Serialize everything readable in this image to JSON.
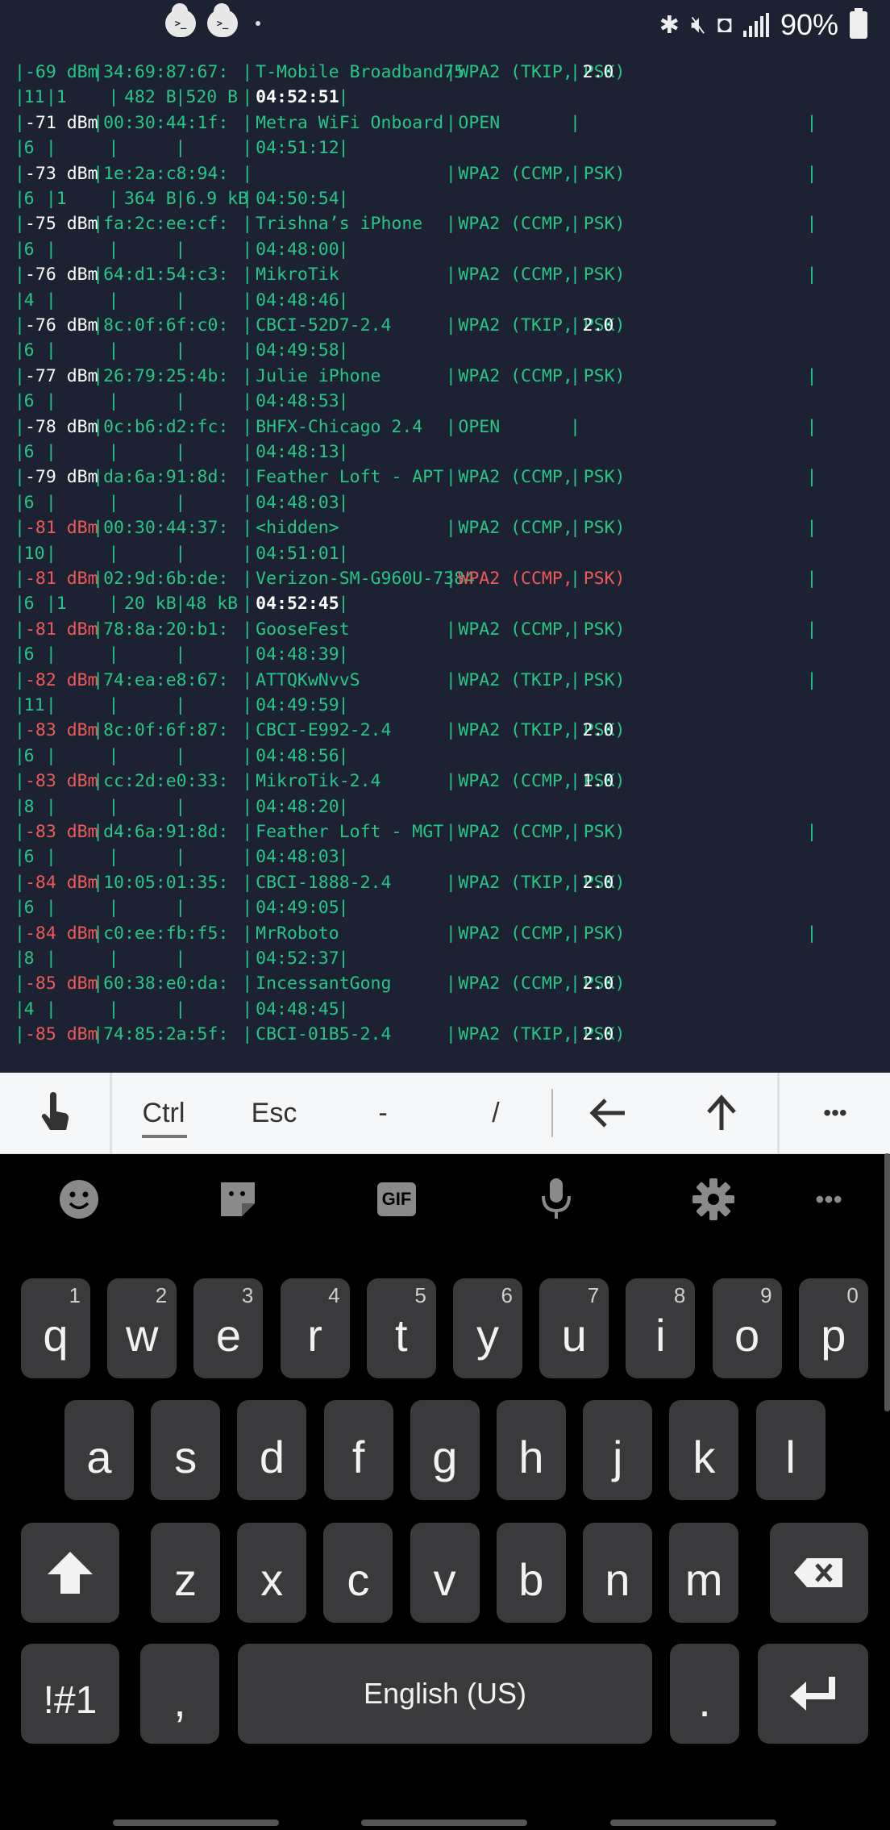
{
  "status_bar": {
    "left_icons": [
      "terminal-cloud-icon",
      "terminal-cloud-icon"
    ],
    "cloud_glyph": ">_",
    "right_icons": [
      "bluetooth-icon",
      "mute-icon",
      "nfc-icon",
      "signal-icon"
    ],
    "battery": "90%"
  },
  "terminal": {
    "rows": [
      [
        {
          "t": "-69 dBm",
          "c": "green"
        },
        {
          "t": "34:69:87:67:",
          "c": "green"
        },
        {
          "t": "T-Mobile Broadband75",
          "c": "green"
        },
        {
          "t": "WPA2 (TKIP, PSK)",
          "c": "green"
        },
        {
          "t": "2.0",
          "c": "white"
        }
      ],
      [
        {
          "t": "11",
          "c": "green"
        },
        {
          "t": "1",
          "c": "green"
        },
        {
          "t": "482 B",
          "c": "green"
        },
        {
          "t": "520 B",
          "c": "green"
        },
        {
          "t": "04:52:51",
          "c": "white bold"
        }
      ],
      [
        {
          "t": "-71 dBm",
          "c": "white"
        },
        {
          "t": "00:30:44:1f:",
          "c": "green"
        },
        {
          "t": "Metra WiFi Onboard",
          "c": "green"
        },
        {
          "t": "OPEN",
          "c": "green"
        }
      ],
      [
        {
          "t": "6",
          "c": "green"
        },
        {
          "t": "",
          "c": "green"
        },
        {
          "t": "",
          "c": "green"
        },
        {
          "t": "",
          "c": "green"
        },
        {
          "t": "04:51:12",
          "c": "green"
        }
      ],
      [
        {
          "t": "-73 dBm",
          "c": "white"
        },
        {
          "t": "1e:2a:c8:94:",
          "c": "green"
        },
        {
          "t": "",
          "c": "green"
        },
        {
          "t": "WPA2 (CCMP, PSK)",
          "c": "green"
        }
      ],
      [
        {
          "t": "6",
          "c": "green"
        },
        {
          "t": "1",
          "c": "green"
        },
        {
          "t": "364 B",
          "c": "green"
        },
        {
          "t": "6.9 kB",
          "c": "green"
        },
        {
          "t": "04:50:54",
          "c": "green"
        }
      ],
      [
        {
          "t": "-75 dBm",
          "c": "white"
        },
        {
          "t": "fa:2c:ee:cf:",
          "c": "green"
        },
        {
          "t": "Trishna’s iPhone",
          "c": "green"
        },
        {
          "t": "WPA2 (CCMP, PSK)",
          "c": "green"
        }
      ],
      [
        {
          "t": "6",
          "c": "green"
        },
        {
          "t": "",
          "c": "green"
        },
        {
          "t": "",
          "c": "green"
        },
        {
          "t": "",
          "c": "green"
        },
        {
          "t": "04:48:00",
          "c": "green"
        }
      ],
      [
        {
          "t": "-76 dBm",
          "c": "white"
        },
        {
          "t": "64:d1:54:c3:",
          "c": "green"
        },
        {
          "t": "MikroTik",
          "c": "green"
        },
        {
          "t": "WPA2 (CCMP, PSK)",
          "c": "green"
        }
      ],
      [
        {
          "t": "4",
          "c": "green"
        },
        {
          "t": "",
          "c": "green"
        },
        {
          "t": "",
          "c": "green"
        },
        {
          "t": "",
          "c": "green"
        },
        {
          "t": "04:48:46",
          "c": "green"
        }
      ],
      [
        {
          "t": "-76 dBm",
          "c": "white"
        },
        {
          "t": "8c:0f:6f:c0:",
          "c": "green"
        },
        {
          "t": "CBCI-52D7-2.4",
          "c": "green"
        },
        {
          "t": "WPA2 (TKIP, PSK)",
          "c": "green"
        },
        {
          "t": "2.0",
          "c": "white"
        }
      ],
      [
        {
          "t": "6",
          "c": "green"
        },
        {
          "t": "",
          "c": "green"
        },
        {
          "t": "",
          "c": "green"
        },
        {
          "t": "",
          "c": "green"
        },
        {
          "t": "04:49:58",
          "c": "green"
        }
      ],
      [
        {
          "t": "-77 dBm",
          "c": "white"
        },
        {
          "t": "26:79:25:4b:",
          "c": "green"
        },
        {
          "t": "Julie iPhone",
          "c": "green"
        },
        {
          "t": "WPA2 (CCMP, PSK)",
          "c": "green"
        }
      ],
      [
        {
          "t": "6",
          "c": "green"
        },
        {
          "t": "",
          "c": "green"
        },
        {
          "t": "",
          "c": "green"
        },
        {
          "t": "",
          "c": "green"
        },
        {
          "t": "04:48:53",
          "c": "green"
        }
      ],
      [
        {
          "t": "-78 dBm",
          "c": "white"
        },
        {
          "t": "0c:b6:d2:fc:",
          "c": "green"
        },
        {
          "t": "BHFX-Chicago 2.4",
          "c": "green"
        },
        {
          "t": "OPEN",
          "c": "green"
        }
      ],
      [
        {
          "t": "6",
          "c": "green"
        },
        {
          "t": "",
          "c": "green"
        },
        {
          "t": "",
          "c": "green"
        },
        {
          "t": "",
          "c": "green"
        },
        {
          "t": "04:48:13",
          "c": "green"
        }
      ],
      [
        {
          "t": "-79 dBm",
          "c": "white"
        },
        {
          "t": "da:6a:91:8d:",
          "c": "green"
        },
        {
          "t": "Feather Loft - APT",
          "c": "green"
        },
        {
          "t": "WPA2 (CCMP, PSK)",
          "c": "green"
        }
      ],
      [
        {
          "t": "6",
          "c": "green"
        },
        {
          "t": "",
          "c": "green"
        },
        {
          "t": "",
          "c": "green"
        },
        {
          "t": "",
          "c": "green"
        },
        {
          "t": "04:48:03",
          "c": "green"
        }
      ],
      [
        {
          "t": "-81 dBm",
          "c": "red"
        },
        {
          "t": "00:30:44:37:",
          "c": "green"
        },
        {
          "t": "<hidden>",
          "c": "green"
        },
        {
          "t": "WPA2 (CCMP, PSK)",
          "c": "green"
        }
      ],
      [
        {
          "t": "10",
          "c": "green"
        },
        {
          "t": "",
          "c": "green"
        },
        {
          "t": "",
          "c": "green"
        },
        {
          "t": "",
          "c": "green"
        },
        {
          "t": "04:51:01",
          "c": "green"
        }
      ],
      [
        {
          "t": "-81 dBm",
          "c": "red"
        },
        {
          "t": "02:9d:6b:de:",
          "c": "green"
        },
        {
          "t": "Verizon-SM-G960U-7384",
          "c": "green"
        },
        {
          "t": "WPA2 (CCMP, PSK)",
          "c": "red"
        }
      ],
      [
        {
          "t": "6",
          "c": "green"
        },
        {
          "t": "1",
          "c": "green"
        },
        {
          "t": "20 kB",
          "c": "green"
        },
        {
          "t": "48 kB",
          "c": "green"
        },
        {
          "t": "04:52:45",
          "c": "white bold"
        }
      ],
      [
        {
          "t": "-81 dBm",
          "c": "red"
        },
        {
          "t": "78:8a:20:b1:",
          "c": "green"
        },
        {
          "t": "GooseFest",
          "c": "green"
        },
        {
          "t": "WPA2 (CCMP, PSK)",
          "c": "green"
        }
      ],
      [
        {
          "t": "6",
          "c": "green"
        },
        {
          "t": "",
          "c": "green"
        },
        {
          "t": "",
          "c": "green"
        },
        {
          "t": "",
          "c": "green"
        },
        {
          "t": "04:48:39",
          "c": "green"
        }
      ],
      [
        {
          "t": "-82 dBm",
          "c": "red"
        },
        {
          "t": "74:ea:e8:67:",
          "c": "green"
        },
        {
          "t": "ATTQKwNvvS",
          "c": "green"
        },
        {
          "t": "WPA2 (TKIP, PSK)",
          "c": "green"
        }
      ],
      [
        {
          "t": "11",
          "c": "green"
        },
        {
          "t": "",
          "c": "green"
        },
        {
          "t": "",
          "c": "green"
        },
        {
          "t": "",
          "c": "green"
        },
        {
          "t": "04:49:59",
          "c": "green"
        }
      ],
      [
        {
          "t": "-83 dBm",
          "c": "red"
        },
        {
          "t": "8c:0f:6f:87:",
          "c": "green"
        },
        {
          "t": "CBCI-E992-2.4",
          "c": "green"
        },
        {
          "t": "WPA2 (TKIP, PSK)",
          "c": "green"
        },
        {
          "t": "2.0",
          "c": "white"
        }
      ],
      [
        {
          "t": "6",
          "c": "green"
        },
        {
          "t": "",
          "c": "green"
        },
        {
          "t": "",
          "c": "green"
        },
        {
          "t": "",
          "c": "green"
        },
        {
          "t": "04:48:56",
          "c": "green"
        }
      ],
      [
        {
          "t": "-83 dBm",
          "c": "red"
        },
        {
          "t": "cc:2d:e0:33:",
          "c": "green"
        },
        {
          "t": "MikroTik-2.4",
          "c": "green"
        },
        {
          "t": "WPA2 (CCMP, PSK)",
          "c": "green"
        },
        {
          "t": "1.0",
          "c": "white"
        }
      ],
      [
        {
          "t": "8",
          "c": "green"
        },
        {
          "t": "",
          "c": "green"
        },
        {
          "t": "",
          "c": "green"
        },
        {
          "t": "",
          "c": "green"
        },
        {
          "t": "04:48:20",
          "c": "green"
        }
      ],
      [
        {
          "t": "-83 dBm",
          "c": "red"
        },
        {
          "t": "d4:6a:91:8d:",
          "c": "green"
        },
        {
          "t": "Feather Loft - MGT",
          "c": "green"
        },
        {
          "t": "WPA2 (CCMP, PSK)",
          "c": "green"
        }
      ],
      [
        {
          "t": "6",
          "c": "green"
        },
        {
          "t": "",
          "c": "green"
        },
        {
          "t": "",
          "c": "green"
        },
        {
          "t": "",
          "c": "green"
        },
        {
          "t": "04:48:03",
          "c": "green"
        }
      ],
      [
        {
          "t": "-84 dBm",
          "c": "red"
        },
        {
          "t": "10:05:01:35:",
          "c": "green"
        },
        {
          "t": "CBCI-1888-2.4",
          "c": "green"
        },
        {
          "t": "WPA2 (TKIP, PSK)",
          "c": "green"
        },
        {
          "t": "2.0",
          "c": "white"
        }
      ],
      [
        {
          "t": "6",
          "c": "green"
        },
        {
          "t": "",
          "c": "green"
        },
        {
          "t": "",
          "c": "green"
        },
        {
          "t": "",
          "c": "green"
        },
        {
          "t": "04:49:05",
          "c": "green"
        }
      ],
      [
        {
          "t": "-84 dBm",
          "c": "red"
        },
        {
          "t": "c0:ee:fb:f5:",
          "c": "green"
        },
        {
          "t": "MrRoboto",
          "c": "green"
        },
        {
          "t": "WPA2 (CCMP, PSK)",
          "c": "green"
        }
      ],
      [
        {
          "t": "8",
          "c": "green"
        },
        {
          "t": "",
          "c": "green"
        },
        {
          "t": "",
          "c": "green"
        },
        {
          "t": "",
          "c": "green"
        },
        {
          "t": "04:52:37",
          "c": "green"
        }
      ],
      [
        {
          "t": "-85 dBm",
          "c": "red"
        },
        {
          "t": "60:38:e0:da:",
          "c": "green"
        },
        {
          "t": "IncessantGong",
          "c": "green"
        },
        {
          "t": "WPA2 (CCMP, PSK)",
          "c": "green"
        },
        {
          "t": "2.0",
          "c": "white"
        }
      ],
      [
        {
          "t": "4",
          "c": "green"
        },
        {
          "t": "",
          "c": "green"
        },
        {
          "t": "",
          "c": "green"
        },
        {
          "t": "",
          "c": "green"
        },
        {
          "t": "04:48:45",
          "c": "green"
        }
      ],
      [
        {
          "t": "-85 dBm",
          "c": "red"
        },
        {
          "t": "74:85:2a:5f:",
          "c": "green"
        },
        {
          "t": "CBCI-01B5-2.4",
          "c": "green"
        },
        {
          "t": "WPA2 (TKIP, PSK)",
          "c": "green"
        },
        {
          "t": "2.0",
          "c": "white"
        }
      ]
    ]
  },
  "toolbar": {
    "touch_icon": "touch-icon",
    "ctrl": "Ctrl",
    "esc": "Esc",
    "dash": "-",
    "slash": "/",
    "left_arrow_icon": "arrow-left-icon",
    "up_arrow_icon": "arrow-up-icon",
    "more": "•••"
  },
  "keyboard": {
    "top_icons": [
      "emoji-icon",
      "sticker-icon",
      "gif-icon",
      "mic-icon",
      "settings-icon",
      "more-icon"
    ],
    "gif_label": "GIF",
    "more_label": "•••",
    "row1": [
      {
        "k": "q",
        "s": "1"
      },
      {
        "k": "w",
        "s": "2"
      },
      {
        "k": "e",
        "s": "3"
      },
      {
        "k": "r",
        "s": "4"
      },
      {
        "k": "t",
        "s": "5"
      },
      {
        "k": "y",
        "s": "6"
      },
      {
        "k": "u",
        "s": "7"
      },
      {
        "k": "i",
        "s": "8"
      },
      {
        "k": "o",
        "s": "9"
      },
      {
        "k": "p",
        "s": "0"
      }
    ],
    "row2": [
      "a",
      "s",
      "d",
      "f",
      "g",
      "h",
      "j",
      "k",
      "l"
    ],
    "row3": [
      "z",
      "x",
      "c",
      "v",
      "b",
      "n",
      "m"
    ],
    "symbols": "!#1",
    "comma": ",",
    "space": "English (US)",
    "period": ".",
    "colors": {
      "key_bg": "#3a3a3c",
      "terminal_bg": "#1c2232",
      "term_green": "#27c587",
      "term_red": "#ee5a5a"
    }
  }
}
